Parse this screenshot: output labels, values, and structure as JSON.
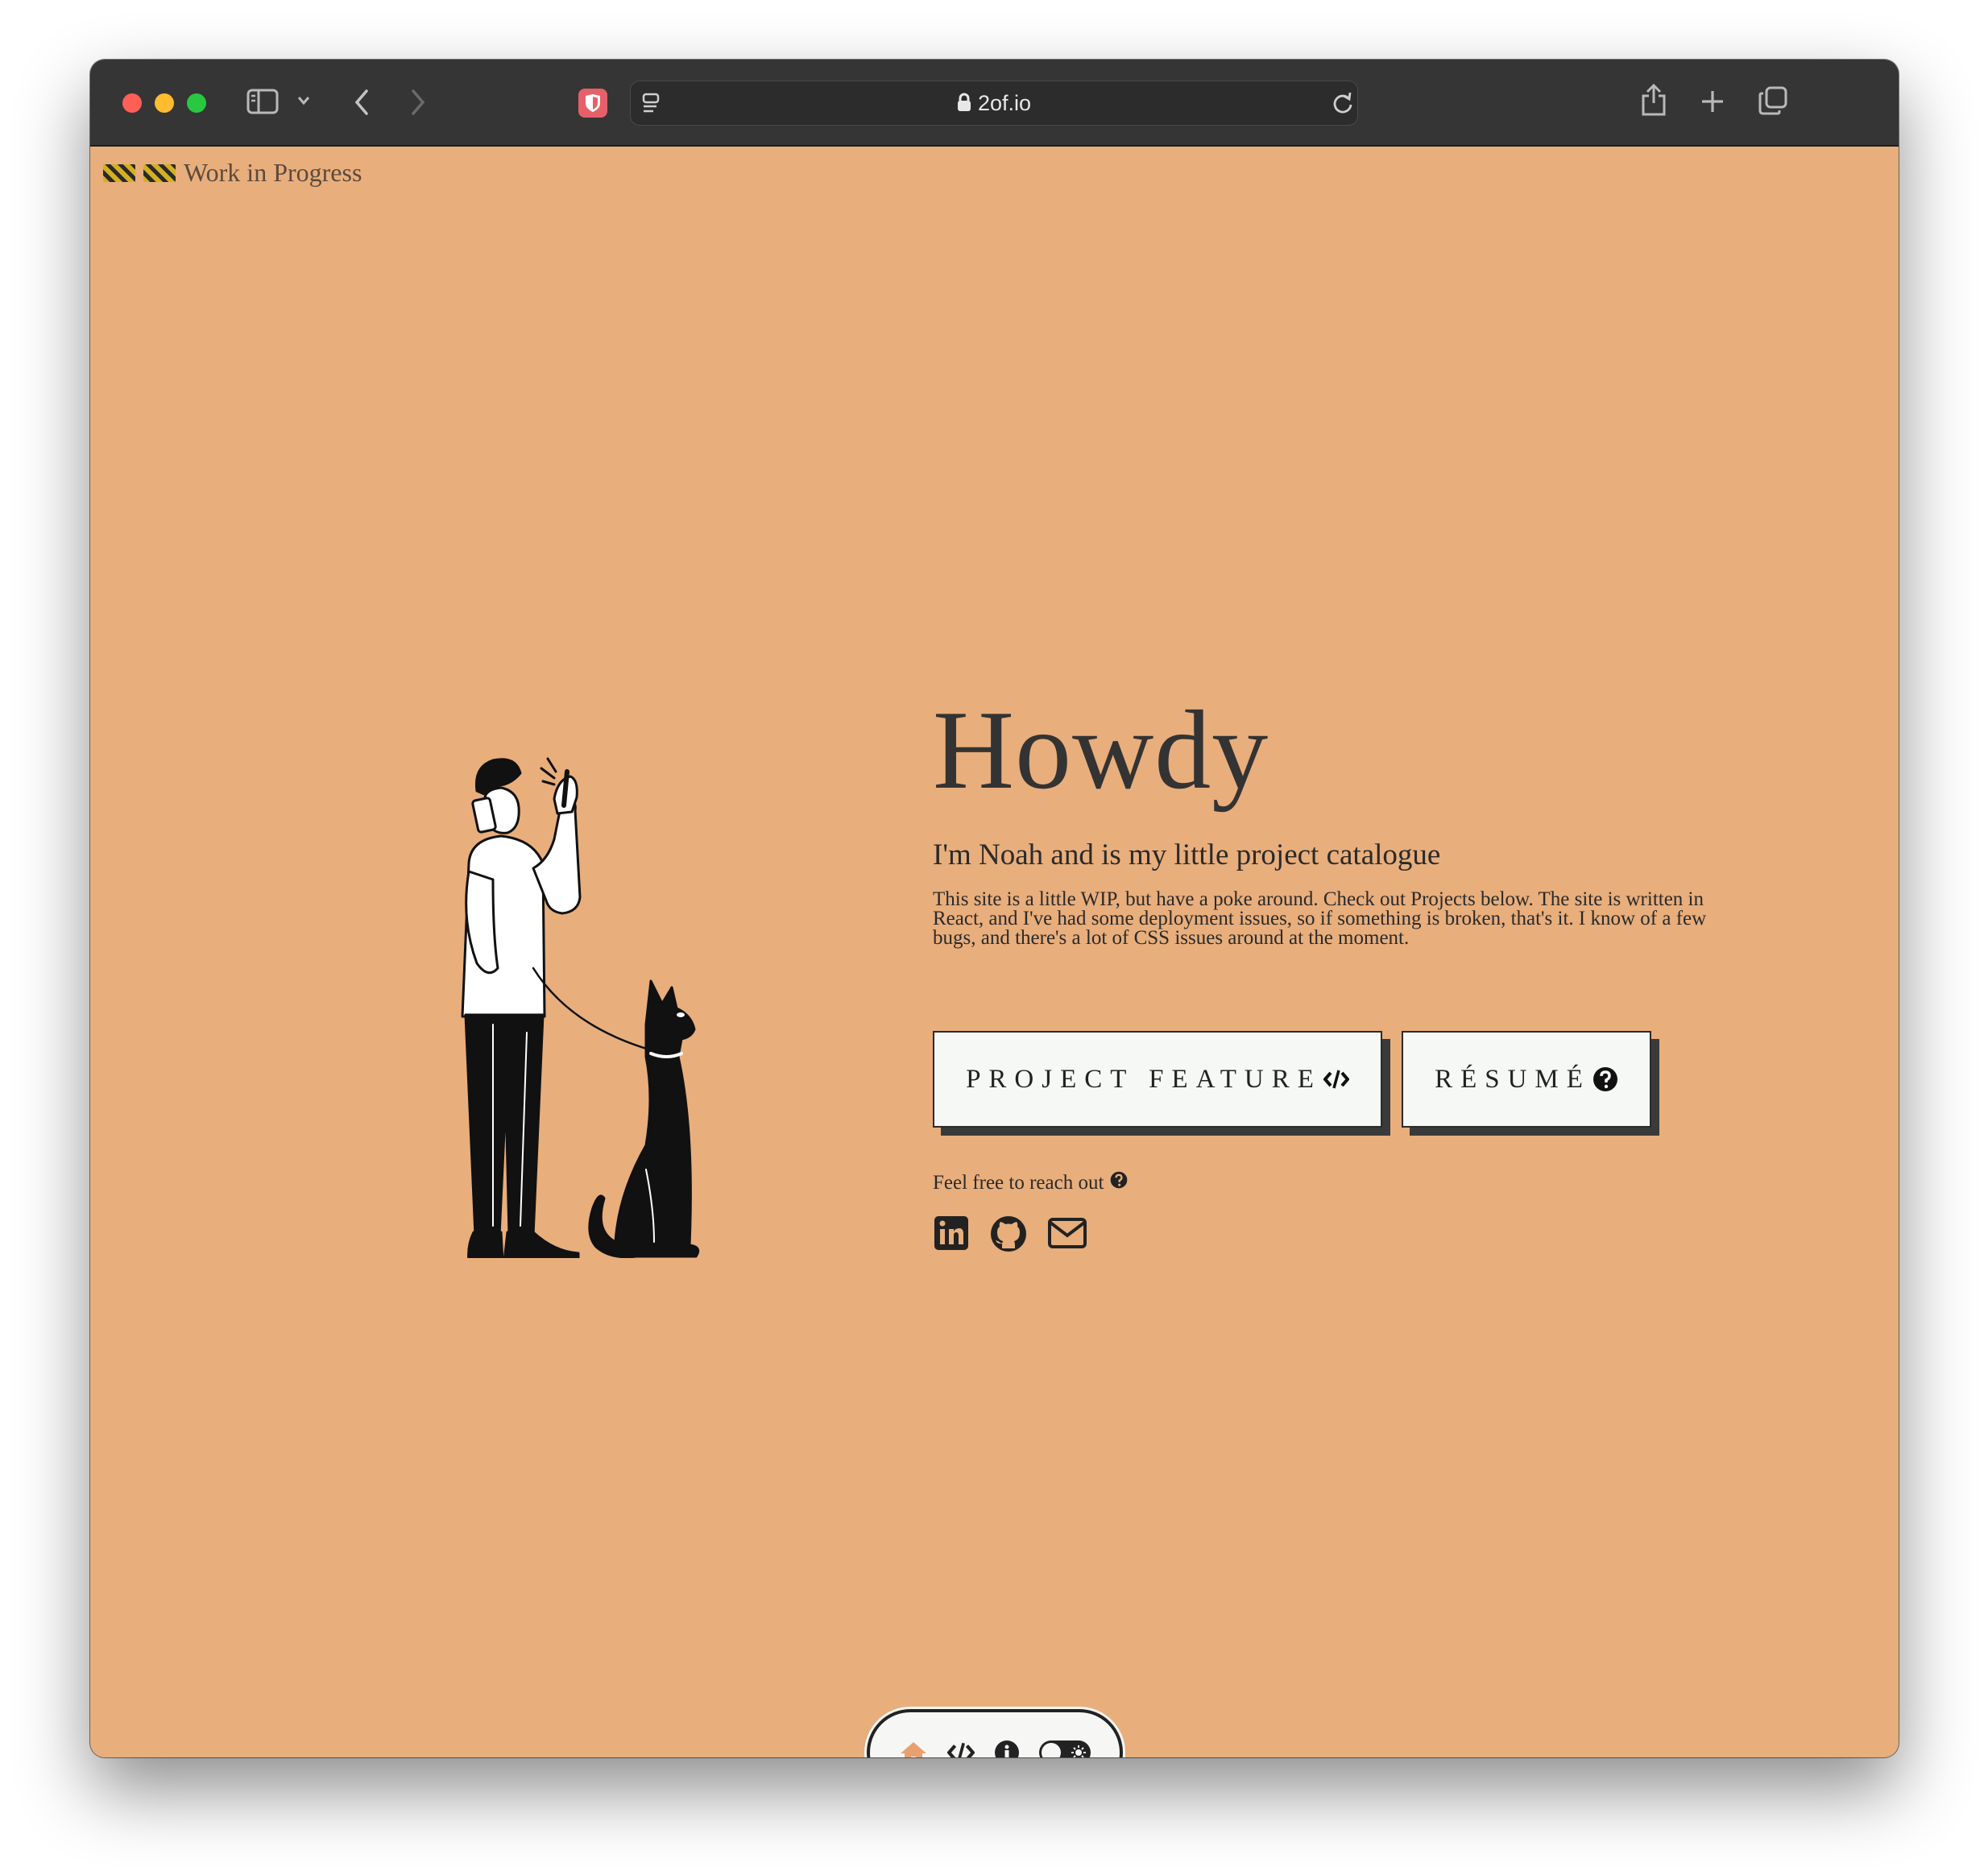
{
  "browser": {
    "url": "2of.io"
  },
  "banner": {
    "label": "Work in Progress"
  },
  "hero": {
    "title": "Howdy",
    "subtitle": "I'm Noah and is my little project catalogue",
    "description": "This site is a little WIP, but have a poke around. Check out Projects below. The site is written in React, and I've had some deployment issues, so if something is broken, that's it. I know of a few bugs, and there's a lot of CSS issues around at the moment."
  },
  "buttons": {
    "project_label": "PROJECT FEATURE",
    "resume_label": "RÉSUMÉ"
  },
  "contact": {
    "reach_label": "Feel free to reach out"
  },
  "colors": {
    "background": "#e8ae7c",
    "accent": "#e8a070",
    "dark": "#222222"
  },
  "icons": {
    "social": [
      "linkedin-icon",
      "github-icon",
      "email-icon"
    ],
    "dock": [
      "home-icon",
      "code-icon",
      "info-icon",
      "theme-toggle"
    ]
  }
}
